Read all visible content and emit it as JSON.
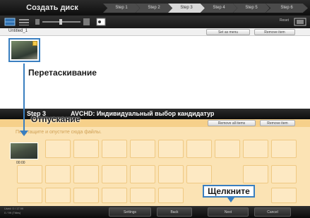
{
  "app_title": "Создать диск",
  "steps": [
    "Step 1",
    "Step 2",
    "Step 3",
    "Step 4",
    "Step 5",
    "Step 6"
  ],
  "active_step_index": 2,
  "toolbar": {
    "preview_label": "Reset"
  },
  "disc": {
    "name": "Untitled_1",
    "btn_left": "Set as menu",
    "btn_right": "Remove item"
  },
  "step3": {
    "label": "Step 3",
    "desc": "AVCHD: Индивидуальный выбор кандидатур"
  },
  "lower_buttons": {
    "left": "Remove all items",
    "right": "Remove item"
  },
  "hint": "Перетащите и опустите сюда файлы.",
  "small_thumb_label": "00:00",
  "annotations": {
    "drag": "Перетаскивание",
    "drop": "Отпускание",
    "click": "Щелкните"
  },
  "bottom": {
    "info_line1": "Used: 0 / 17.99",
    "info_line2": "0 / 99 (Titles)",
    "buttons": [
      "Settings",
      "Back",
      "Next",
      "Cancel"
    ]
  },
  "colors": {
    "accent_blue": "#3a7fc0",
    "lower_bg": "#fbe3b4"
  }
}
